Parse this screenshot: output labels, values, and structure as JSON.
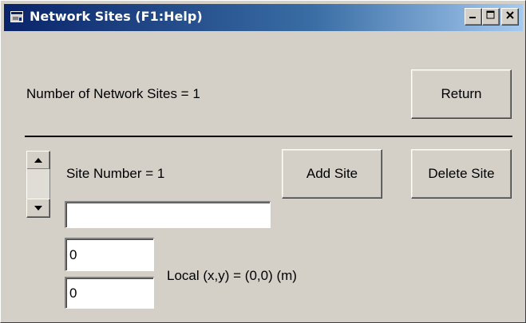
{
  "window": {
    "title": "Network Sites (F1:Help)",
    "minimize_symbol": "_",
    "close_symbol": "✕",
    "title_gradient_start": "#0a246a",
    "title_gradient_end": "#a6caf0",
    "face_color": "#d4d0c8"
  },
  "header": {
    "count_label": "Number of Network Sites = 1",
    "return_label": "Return"
  },
  "site": {
    "number_label": "Site Number = 1",
    "add_label": "Add Site",
    "delete_label": "Delete Site",
    "name_value": "",
    "x_value": "0",
    "y_value": "0",
    "local_label": "Local (x,y) = (0,0) (m)"
  },
  "icons": {
    "app": "app-icon",
    "spin_up": "arrow-up-icon",
    "spin_down": "arrow-down-icon"
  }
}
